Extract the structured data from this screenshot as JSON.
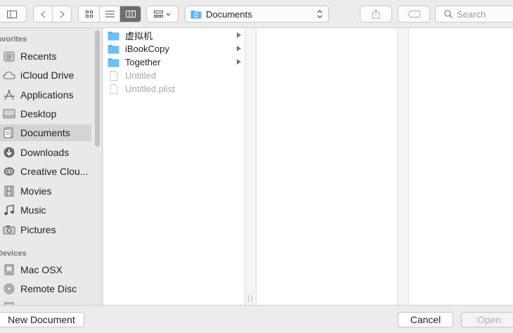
{
  "toolbar": {
    "location": "Documents",
    "search_placeholder": "Search"
  },
  "sidebar": {
    "favorites_heading": "avorites",
    "devices_heading": "Devices",
    "favorites": [
      {
        "label": "Recents",
        "icon": "recents-icon"
      },
      {
        "label": "iCloud Drive",
        "icon": "cloud-icon"
      },
      {
        "label": "Applications",
        "icon": "applications-icon"
      },
      {
        "label": "Desktop",
        "icon": "desktop-icon"
      },
      {
        "label": "Documents",
        "icon": "documents-icon",
        "selected": true
      },
      {
        "label": "Downloads",
        "icon": "downloads-icon"
      },
      {
        "label": "Creative Clou...",
        "icon": "creative-cloud-icon"
      },
      {
        "label": "Movies",
        "icon": "movies-icon"
      },
      {
        "label": "Music",
        "icon": "music-icon"
      },
      {
        "label": "Pictures",
        "icon": "pictures-icon"
      }
    ],
    "devices": [
      {
        "label": "Mac OSX",
        "icon": "hard-disk-icon"
      },
      {
        "label": "Remote Disc",
        "icon": "remote-disc-icon"
      }
    ]
  },
  "column1": {
    "items": [
      {
        "label": "虚拟机",
        "type": "folder"
      },
      {
        "label": "iBookCopy",
        "type": "folder"
      },
      {
        "label": "Together",
        "type": "folder"
      },
      {
        "label": "Untitled",
        "type": "file"
      },
      {
        "label": "Untitled.plist",
        "type": "file"
      }
    ]
  },
  "bottom": {
    "new_document": "New Document",
    "cancel": "Cancel",
    "open": "Open"
  },
  "colors": {
    "folder_blue": "#5ab4f0",
    "selected_row": "#d4d4d4"
  }
}
